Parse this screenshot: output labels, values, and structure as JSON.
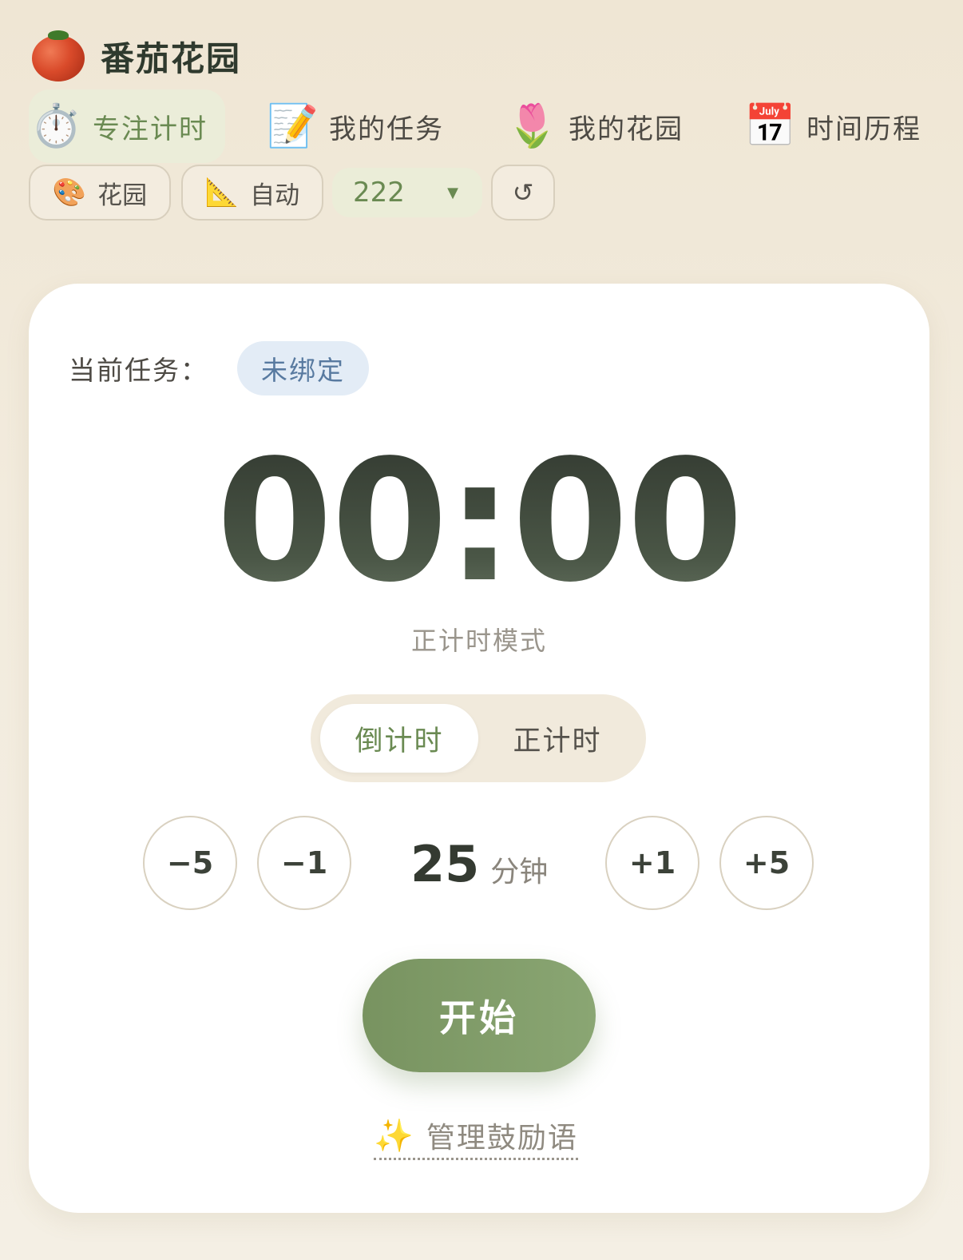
{
  "app": {
    "title": "番茄花园",
    "logo_icon": "tomato-icon"
  },
  "nav": {
    "tabs": [
      {
        "label": "专注计时",
        "emoji": "⏱️",
        "icon": "stopwatch-icon",
        "active": true
      },
      {
        "label": "我的任务",
        "emoji": "📝",
        "icon": "memo-icon",
        "active": false
      },
      {
        "label": "我的花园",
        "emoji": "🌷",
        "icon": "tulip-icon",
        "active": false
      },
      {
        "label": "时间历程",
        "emoji": "📅",
        "icon": "calendar-icon",
        "active": false
      }
    ]
  },
  "controls": {
    "garden": {
      "label": "花园",
      "emoji": "🎨",
      "icon": "palette-icon"
    },
    "auto": {
      "label": "自动",
      "emoji": "📐",
      "icon": "triangle-ruler-icon"
    },
    "select_value": "222",
    "caret": "▼",
    "reset_glyph": "↺"
  },
  "card": {
    "task_label": "当前任务：",
    "task_value": "未绑定",
    "timer": "00:00",
    "mode_text": "正计时模式",
    "modes": {
      "countdown": "倒计时",
      "countup": "正计时",
      "active": "countdown"
    },
    "adjust": {
      "minus5": "−5",
      "minus1": "−1",
      "plus1": "+1",
      "plus5": "+5"
    },
    "duration_value": "25",
    "duration_unit": "分钟",
    "start_label": "开始",
    "encourage_emoji": "✨",
    "encourage_label": "管理鼓励语"
  },
  "colors": {
    "accent_green": "#6a8a52",
    "start_button": "#7f9a68",
    "badge_blue_bg": "#e3ecf6",
    "badge_blue_text": "#587aa0"
  }
}
